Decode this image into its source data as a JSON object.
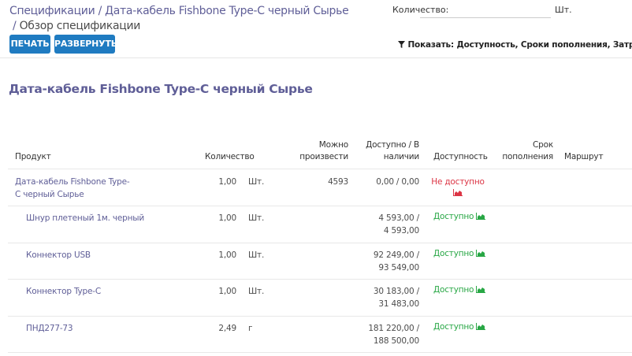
{
  "breadcrumb": {
    "level1": "Спецификации",
    "separator": "/",
    "level2": "Дата-кабель Fishbone Type-C черный Сырье",
    "level3": "Обзор спецификации"
  },
  "buttons": {
    "print": "ПЕЧАТЬ",
    "expand": "РАЗВЕРНУТЬ"
  },
  "quantity": {
    "label": "Количество:",
    "value": "",
    "uom": "Шт."
  },
  "filter": {
    "text": "Показать: Доступность, Сроки пополнения, Затраты, Операции"
  },
  "report": {
    "title": "Дата-кабель Fishbone Type-C черный Сырье"
  },
  "table": {
    "headers": {
      "product": "Продукт",
      "quantity": "Количество",
      "producible_1": "Можно",
      "producible_2": "произвести",
      "available_1": "Доступно / В",
      "available_2": "наличии",
      "availability": "Доступность",
      "lead_1": "Срок",
      "lead_2": "пополнения",
      "route": "Маршрут"
    },
    "rows": [
      {
        "name1": "Дата-кабель Fishbone Type-",
        "name2": "C черный Сырье",
        "qty": "1,00",
        "uom": "Шт.",
        "producible": "4593",
        "avail1": "0,00 / 0,00",
        "avail2": "",
        "status": "Не доступно",
        "status_ok": false
      },
      {
        "name1": "Шнур плетеный 1м. черный",
        "name2": "",
        "qty": "1,00",
        "uom": "Шт.",
        "producible": "",
        "avail1": "4 593,00 /",
        "avail2": "4 593,00",
        "status": "Доступно",
        "status_ok": true
      },
      {
        "name1": "Коннектор USB",
        "name2": "",
        "qty": "1,00",
        "uom": "Шт.",
        "producible": "",
        "avail1": "92 249,00 /",
        "avail2": "93 549,00",
        "status": "Доступно",
        "status_ok": true
      },
      {
        "name1": "Коннектор Type-C",
        "name2": "",
        "qty": "1,00",
        "uom": "Шт.",
        "producible": "",
        "avail1": "30 183,00 /",
        "avail2": "31 483,00",
        "status": "Доступно",
        "status_ok": true
      },
      {
        "name1": "ПНД277-73",
        "name2": "",
        "qty": "2,49",
        "uom": "г",
        "producible": "",
        "avail1": "181 220,00 /",
        "avail2": "188 500,00",
        "status": "Доступно",
        "status_ok": true
      }
    ]
  },
  "colors": {
    "link": "#5f5e97",
    "button": "#1f7bc1",
    "available": "#28a745",
    "unavailable": "#dc3545"
  },
  "icons": {
    "chart": "area-chart-icon",
    "filter": "filter-icon"
  }
}
